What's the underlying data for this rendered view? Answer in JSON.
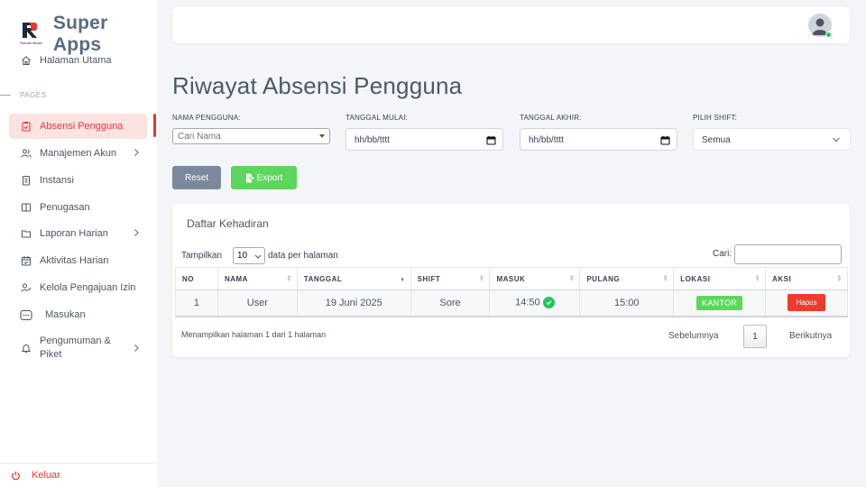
{
  "brand": {
    "title": "Super Apps",
    "logo_text": "Rumah Mesin"
  },
  "sidebar": {
    "pages_label": "PAGES",
    "items": [
      {
        "label": "Halaman Utama",
        "icon": "home-icon"
      },
      {
        "label": "Absensi Pengguna",
        "icon": "clipboard-check-icon",
        "active": true
      },
      {
        "label": "Manajemen Akun",
        "icon": "users-icon",
        "has_chevron": true
      },
      {
        "label": "Instansi",
        "icon": "building-icon"
      },
      {
        "label": "Penugasan",
        "icon": "book-icon"
      },
      {
        "label": "Laporan Harian",
        "icon": "folder-icon",
        "has_chevron": true
      },
      {
        "label": "Aktivitas Harian",
        "icon": "calendar-check-icon"
      },
      {
        "label": "Kelola Pengajuan Izin",
        "icon": "user-check-icon"
      },
      {
        "label": "Masukan",
        "icon": "message-icon"
      },
      {
        "label": "Pengumuman & Piket",
        "icon": "bell-icon",
        "has_chevron": true
      }
    ],
    "logout_label": "Keluar"
  },
  "page": {
    "title": "Riwayat Absensi Pengguna"
  },
  "filters": {
    "name_label": "NAMA PENGGUNA:",
    "name_placeholder": "Cari Nama",
    "start_label": "TANGGAL MULAI:",
    "start_value": "hh/bb/tttt",
    "end_label": "TANGGAL AKHIR:",
    "end_value": "hh/bb/tttt",
    "shift_label": "PILIH SHIFT:",
    "shift_value": "Semua",
    "reset_label": "Reset",
    "export_label": "Export"
  },
  "card": {
    "title": "Daftar Kehadiran",
    "show_label": "Tampilkan",
    "page_length": "10",
    "per_page_suffix": "data per halaman",
    "search_label": "Cari:",
    "columns": [
      "NO",
      "NAMA",
      "TANGGAL",
      "SHIFT",
      "MASUK",
      "PULANG",
      "LOKASI",
      "AKSI"
    ],
    "rows": [
      {
        "no": "1",
        "nama": "User",
        "tanggal": "19 Juni 2025",
        "shift": "Sore",
        "masuk": "14:50",
        "pulang": "15:00",
        "lokasi": "KANTOR",
        "aksi": "Hapus"
      }
    ],
    "info": "Menampilkan halaman 1 dari 1 halaman",
    "prev_label": "Sebelumnya",
    "current_page": "1",
    "next_label": "Berikutnya"
  },
  "colors": {
    "accent": "#e53935",
    "success": "#5cd65c",
    "danger": "#ef3b2d",
    "muted_button": "#7a8a9c"
  }
}
